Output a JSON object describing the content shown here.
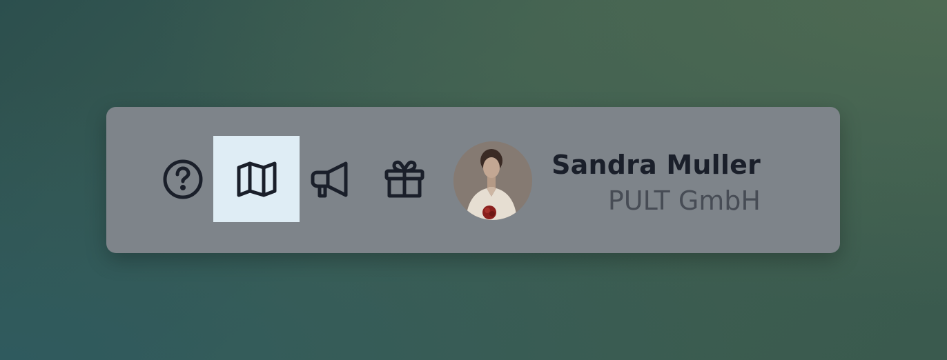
{
  "toolbar": {
    "buttons": [
      {
        "name": "help",
        "icon": "question-circle-icon",
        "active": false
      },
      {
        "name": "map",
        "icon": "map-icon",
        "active": true
      },
      {
        "name": "announcements",
        "icon": "megaphone-icon",
        "active": false
      },
      {
        "name": "gifts",
        "icon": "gift-icon",
        "active": false
      }
    ],
    "active_color": "#dfedf5",
    "icon_color": "#1a1f2a"
  },
  "user": {
    "name": "Sandra Muller",
    "company": "PULT GmbH",
    "avatar_icon": "user-avatar-photo"
  }
}
